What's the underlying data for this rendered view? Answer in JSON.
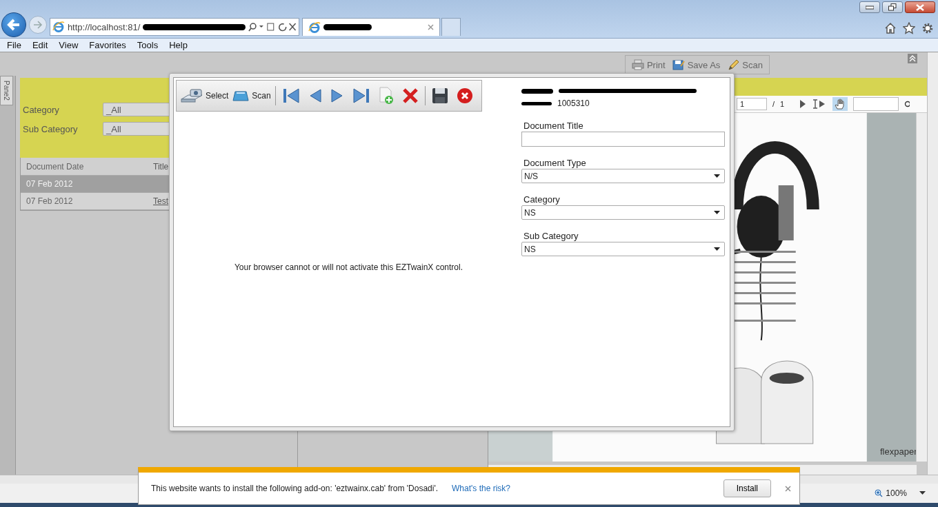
{
  "browser": {
    "url": "http://localhost:81/",
    "menu": [
      "File",
      "Edit",
      "View",
      "Favorites",
      "Tools",
      "Help"
    ]
  },
  "page_toolbar": [
    {
      "kind": "print",
      "label": "Print"
    },
    {
      "kind": "save",
      "label": "Save As"
    },
    {
      "kind": "scan",
      "label": "Scan"
    }
  ],
  "side_tab": "Pane2",
  "filters": [
    {
      "label": "Category",
      "value": "_All"
    },
    {
      "label": "Sub Category",
      "value": "_All"
    }
  ],
  "grid": {
    "columns": [
      "Document Date",
      "Title"
    ],
    "rows": [
      {
        "date": "07 Feb 2012",
        "selected": true
      },
      {
        "date": "07 Feb 2012",
        "title": "Test",
        "selected": false
      }
    ]
  },
  "viewer": {
    "page": "1",
    "separator": "/",
    "total": "1",
    "brand": "flexpaper",
    "hand_tool": {
      "selected": true
    }
  },
  "dialog": {
    "toolbar": [
      {
        "kind": "select",
        "label": "Select"
      },
      {
        "kind": "scan",
        "label": "Scan"
      },
      {
        "kind": "separator"
      },
      {
        "kind": "first"
      },
      {
        "kind": "prev"
      },
      {
        "kind": "next"
      },
      {
        "kind": "last"
      },
      {
        "kind": "add"
      },
      {
        "kind": "delete"
      },
      {
        "kind": "separator"
      },
      {
        "kind": "save"
      },
      {
        "kind": "close"
      }
    ],
    "message": "Your browser cannot or will not activate this EZTwainX control.",
    "record_number": "1005310",
    "fields": [
      {
        "kind": "text",
        "label": "Document Title"
      },
      {
        "kind": "select",
        "label": "Document Type",
        "value": "N/S"
      },
      {
        "kind": "select",
        "label": "Category",
        "value": "NS"
      },
      {
        "kind": "select",
        "label": "Sub Category",
        "value": "NS"
      }
    ]
  },
  "notification": {
    "message": "This website wants to install the following add-on: 'eztwainx.cab' from 'Dosadi'.",
    "link": "What's the risk?",
    "button": "Install"
  },
  "status_bar": {
    "zoom": "100%"
  }
}
